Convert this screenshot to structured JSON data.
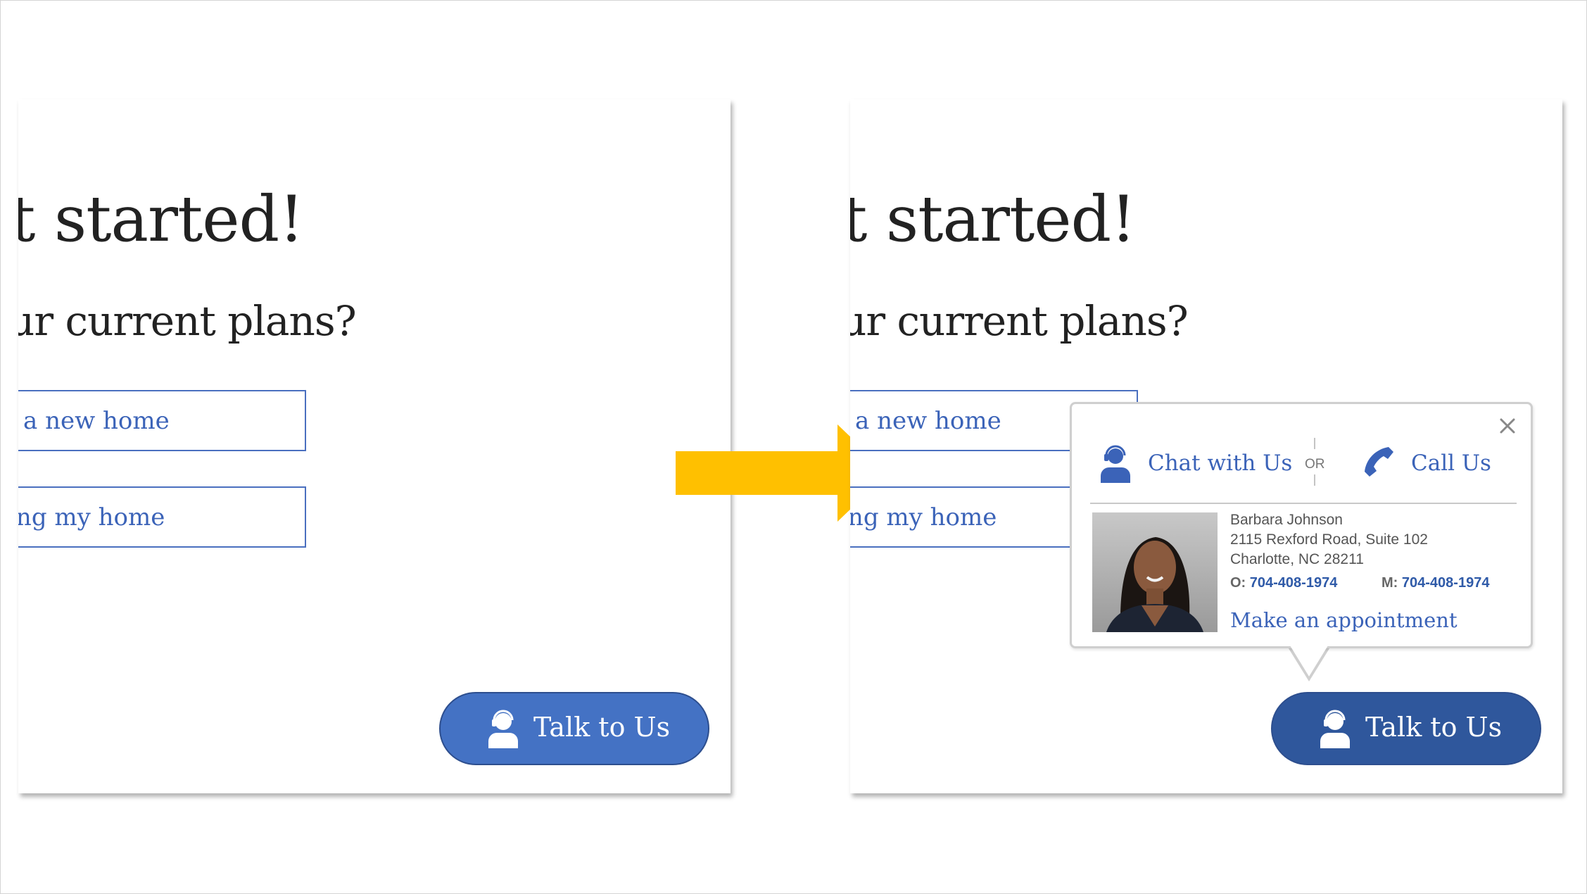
{
  "screens": {
    "before": {
      "headline": "et started!",
      "question": "ur current plans?",
      "options": [
        "a new home",
        "cing my home"
      ],
      "talk_button": "Talk to Us"
    },
    "after": {
      "headline": "et started!",
      "question": "ur current plans?",
      "options": [
        "a new home",
        "cing my home"
      ],
      "talk_button": "Talk to Us"
    }
  },
  "popup": {
    "chat_label": "Chat with Us",
    "or_label": "OR",
    "call_label": "Call Us",
    "agent": {
      "name": "Barbara Johnson",
      "address_line1": "2115 Rexford Road, Suite 102",
      "address_line2": "Charlotte, NC 28211",
      "office_label": "O:",
      "office_phone": "704-408-1974",
      "mobile_label": "M:",
      "mobile_phone": "704-408-1974"
    },
    "appointment_label": "Make an appointment"
  },
  "colors": {
    "brand_blue": "#4472c4",
    "brand_blue_dark": "#2f579c",
    "link_blue": "#3b63b8",
    "arrow_yellow": "#ffc000"
  },
  "icons": [
    "agent-headset-icon",
    "phone-icon",
    "close-icon",
    "arrow-right-icon"
  ]
}
